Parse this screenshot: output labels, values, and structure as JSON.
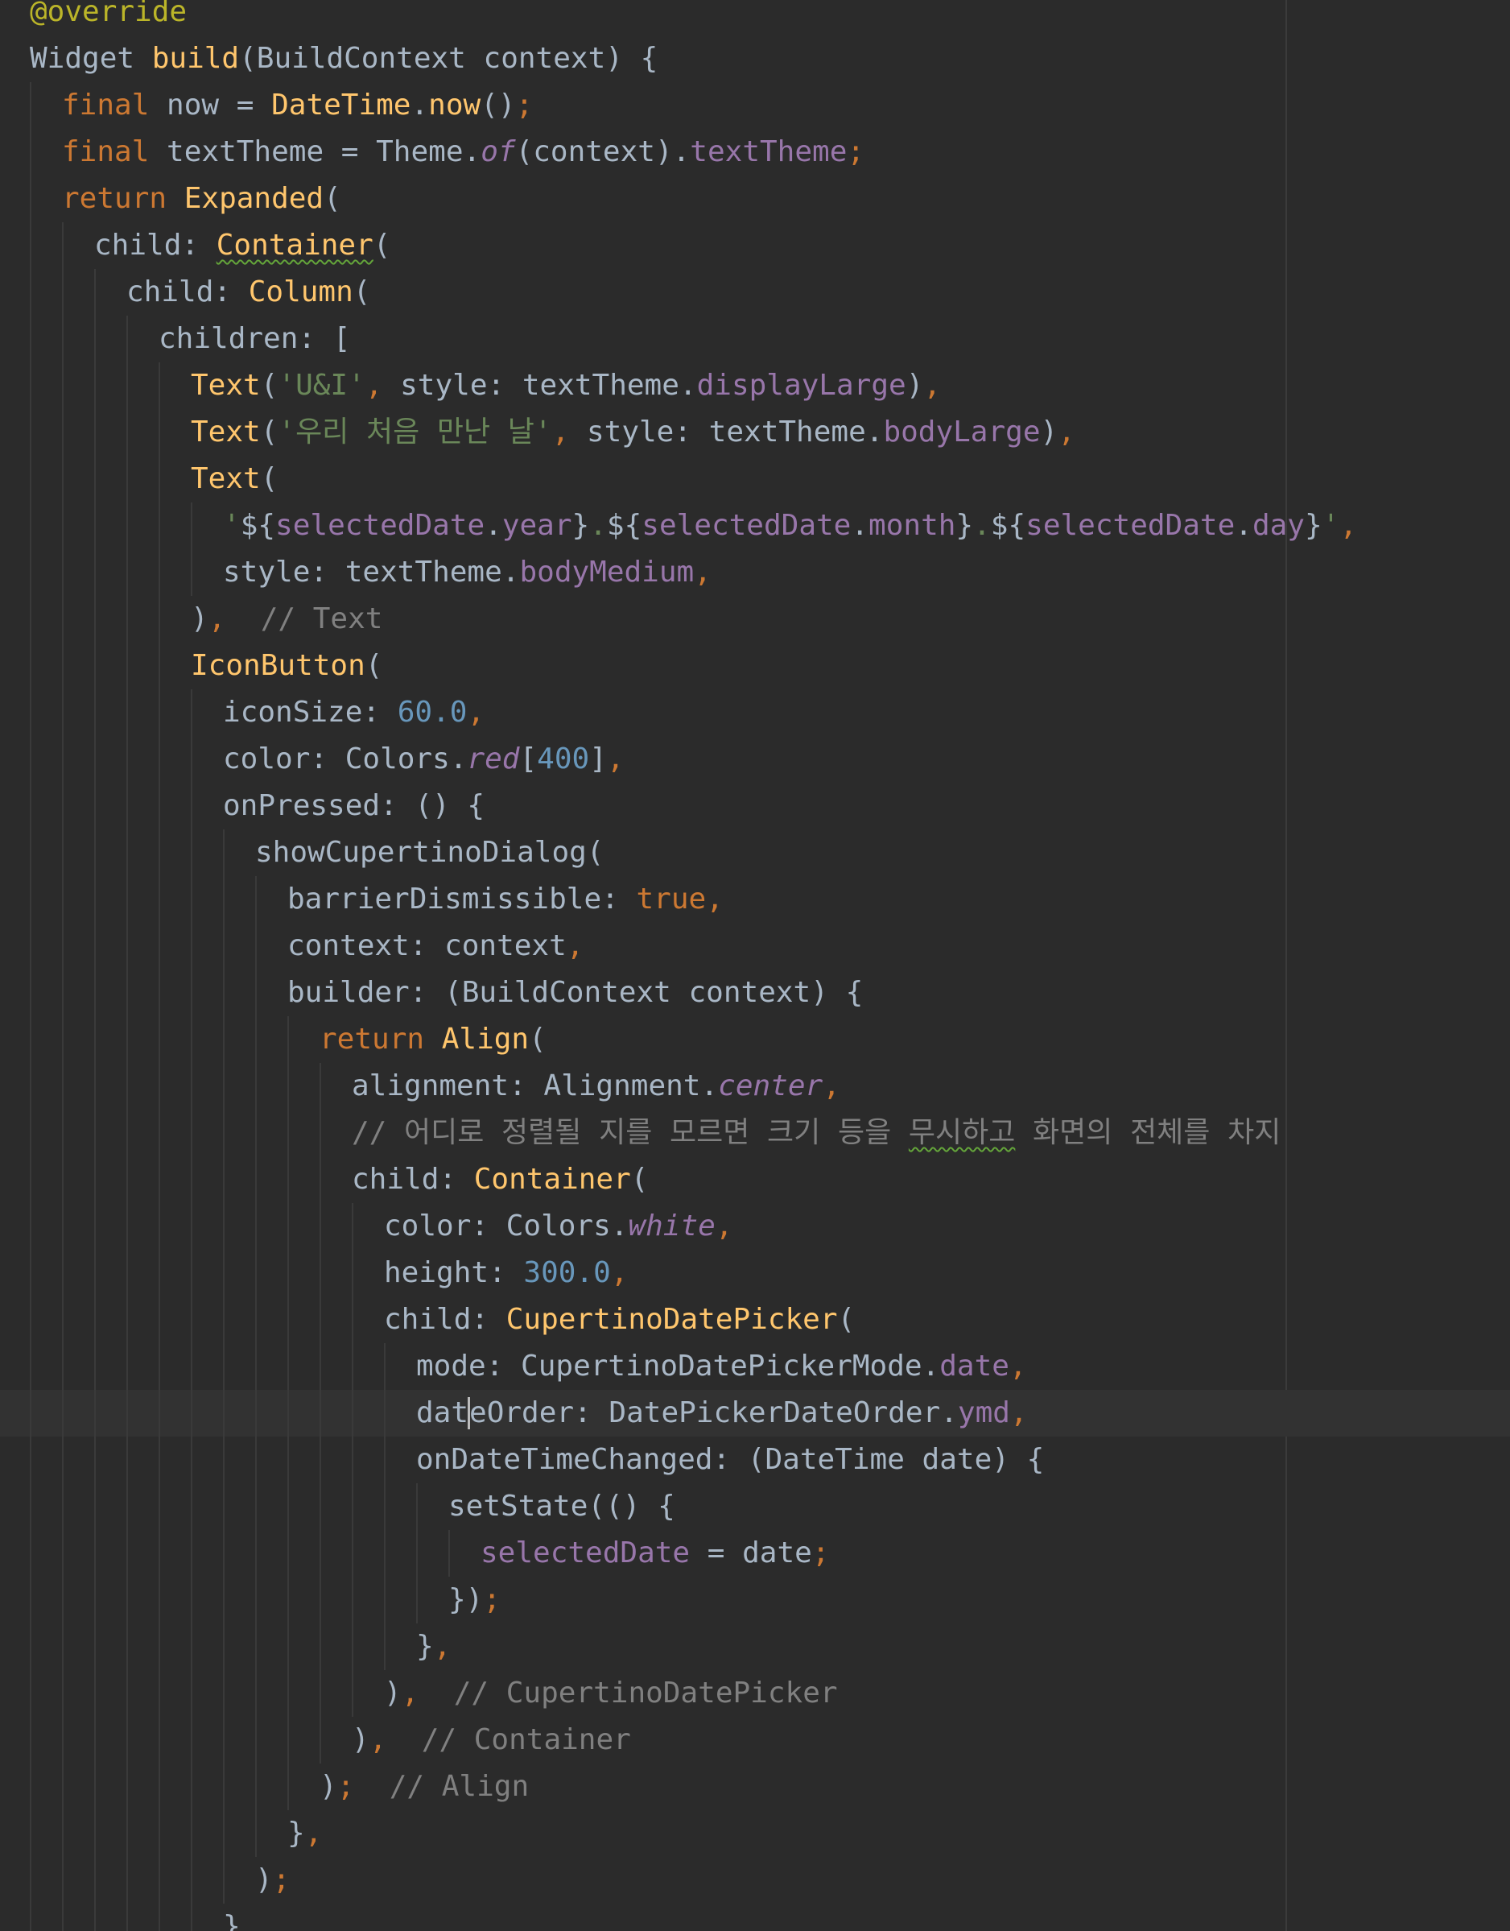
{
  "editor": {
    "colors": {
      "background": "#2b2b2b",
      "current_line": "#323232",
      "default_text": "#a9b7c6",
      "keyword": "#cc7832",
      "class_or_function": "#ffc66d",
      "string": "#6a8759",
      "number": "#6897bb",
      "field": "#9876aa",
      "comment": "#808080",
      "annotation": "#bbb529"
    },
    "current_line_index": 30,
    "lines": [
      {
        "indent": 0,
        "tokens": [
          {
            "t": "@override",
            "c": "ann"
          }
        ]
      },
      {
        "indent": 0,
        "tokens": [
          {
            "t": "Widget ",
            "c": "text"
          },
          {
            "t": "build",
            "c": "fn"
          },
          {
            "t": "(BuildContext context) {",
            "c": "text"
          }
        ]
      },
      {
        "indent": 1,
        "tokens": [
          {
            "t": "final ",
            "c": "kw"
          },
          {
            "t": "now = ",
            "c": "text"
          },
          {
            "t": "DateTime",
            "c": "cls"
          },
          {
            "t": ".",
            "c": "text"
          },
          {
            "t": "now",
            "c": "fn"
          },
          {
            "t": "()",
            "c": "text"
          },
          {
            "t": ";",
            "c": "punc"
          }
        ]
      },
      {
        "indent": 1,
        "tokens": [
          {
            "t": "final ",
            "c": "kw"
          },
          {
            "t": "textTheme = Theme.",
            "c": "text"
          },
          {
            "t": "of",
            "c": "stat"
          },
          {
            "t": "(context).",
            "c": "text"
          },
          {
            "t": "textTheme",
            "c": "fld"
          },
          {
            "t": ";",
            "c": "punc"
          }
        ]
      },
      {
        "indent": 1,
        "tokens": [
          {
            "t": "return ",
            "c": "kw"
          },
          {
            "t": "Expanded",
            "c": "cls"
          },
          {
            "t": "(",
            "c": "text"
          }
        ]
      },
      {
        "indent": 2,
        "tokens": [
          {
            "t": "child: ",
            "c": "text"
          },
          {
            "t": "Container",
            "c": "cls",
            "u": "warn"
          },
          {
            "t": "(",
            "c": "text"
          }
        ]
      },
      {
        "indent": 3,
        "tokens": [
          {
            "t": "child: ",
            "c": "text"
          },
          {
            "t": "Column",
            "c": "cls"
          },
          {
            "t": "(",
            "c": "text"
          }
        ]
      },
      {
        "indent": 4,
        "tokens": [
          {
            "t": "children: [",
            "c": "text"
          }
        ]
      },
      {
        "indent": 5,
        "tokens": [
          {
            "t": "Text",
            "c": "cls"
          },
          {
            "t": "(",
            "c": "text"
          },
          {
            "t": "'U&I'",
            "c": "str"
          },
          {
            "t": ", ",
            "c": "punc"
          },
          {
            "t": "style: textTheme.",
            "c": "text"
          },
          {
            "t": "displayLarge",
            "c": "fld"
          },
          {
            "t": ")",
            "c": "text"
          },
          {
            "t": ",",
            "c": "punc"
          }
        ]
      },
      {
        "indent": 5,
        "tokens": [
          {
            "t": "Text",
            "c": "cls"
          },
          {
            "t": "(",
            "c": "text"
          },
          {
            "t": "'우리 처음 만난 날'",
            "c": "str"
          },
          {
            "t": ", ",
            "c": "punc"
          },
          {
            "t": "style: textTheme.",
            "c": "text"
          },
          {
            "t": "bodyLarge",
            "c": "fld"
          },
          {
            "t": ")",
            "c": "text"
          },
          {
            "t": ",",
            "c": "punc"
          }
        ]
      },
      {
        "indent": 5,
        "tokens": [
          {
            "t": "Text",
            "c": "cls"
          },
          {
            "t": "(",
            "c": "text"
          }
        ]
      },
      {
        "indent": 6,
        "tokens": [
          {
            "t": "'",
            "c": "str"
          },
          {
            "t": "${",
            "c": "text"
          },
          {
            "t": "selectedDate",
            "c": "fld"
          },
          {
            "t": ".",
            "c": "text"
          },
          {
            "t": "year",
            "c": "fld"
          },
          {
            "t": "}",
            "c": "text"
          },
          {
            "t": ".",
            "c": "str"
          },
          {
            "t": "${",
            "c": "text"
          },
          {
            "t": "selectedDate",
            "c": "fld"
          },
          {
            "t": ".",
            "c": "text"
          },
          {
            "t": "month",
            "c": "fld"
          },
          {
            "t": "}",
            "c": "text"
          },
          {
            "t": ".",
            "c": "str"
          },
          {
            "t": "${",
            "c": "text"
          },
          {
            "t": "selectedDate",
            "c": "fld"
          },
          {
            "t": ".",
            "c": "text"
          },
          {
            "t": "day",
            "c": "fld"
          },
          {
            "t": "}",
            "c": "text"
          },
          {
            "t": "'",
            "c": "str"
          },
          {
            "t": ",",
            "c": "punc"
          }
        ]
      },
      {
        "indent": 6,
        "tokens": [
          {
            "t": "style: textTheme.",
            "c": "text"
          },
          {
            "t": "bodyMedium",
            "c": "fld"
          },
          {
            "t": ",",
            "c": "punc"
          }
        ]
      },
      {
        "indent": 5,
        "tokens": [
          {
            "t": ")",
            "c": "text"
          },
          {
            "t": ",",
            "c": "punc"
          },
          {
            "t": "  // Text",
            "c": "cmt"
          }
        ]
      },
      {
        "indent": 5,
        "tokens": [
          {
            "t": "IconButton",
            "c": "cls"
          },
          {
            "t": "(",
            "c": "text"
          }
        ]
      },
      {
        "indent": 6,
        "tokens": [
          {
            "t": "iconSize: ",
            "c": "text"
          },
          {
            "t": "60.0",
            "c": "num"
          },
          {
            "t": ",",
            "c": "punc"
          }
        ]
      },
      {
        "indent": 6,
        "tokens": [
          {
            "t": "color: Colors.",
            "c": "text"
          },
          {
            "t": "red",
            "c": "stat"
          },
          {
            "t": "[",
            "c": "text"
          },
          {
            "t": "400",
            "c": "num"
          },
          {
            "t": "]",
            "c": "text"
          },
          {
            "t": ",",
            "c": "punc"
          }
        ]
      },
      {
        "indent": 6,
        "tokens": [
          {
            "t": "onPressed: () {",
            "c": "text"
          }
        ]
      },
      {
        "indent": 7,
        "tokens": [
          {
            "t": "showCupertinoDialog(",
            "c": "text"
          }
        ]
      },
      {
        "indent": 8,
        "tokens": [
          {
            "t": "barrierDismissible: ",
            "c": "text"
          },
          {
            "t": "true",
            "c": "kw"
          },
          {
            "t": ",",
            "c": "punc"
          }
        ]
      },
      {
        "indent": 8,
        "tokens": [
          {
            "t": "context: context",
            "c": "text"
          },
          {
            "t": ",",
            "c": "punc"
          }
        ]
      },
      {
        "indent": 8,
        "tokens": [
          {
            "t": "builder: (BuildContext context) {",
            "c": "text"
          }
        ]
      },
      {
        "indent": 9,
        "tokens": [
          {
            "t": "return ",
            "c": "kw"
          },
          {
            "t": "Align",
            "c": "cls"
          },
          {
            "t": "(",
            "c": "text"
          }
        ]
      },
      {
        "indent": 10,
        "tokens": [
          {
            "t": "alignment: Alignment.",
            "c": "text"
          },
          {
            "t": "center",
            "c": "stat"
          },
          {
            "t": ",",
            "c": "punc"
          }
        ]
      },
      {
        "indent": 10,
        "tokens": [
          {
            "t": "// 어디로 정렬될 지를 모르면 크기 등을 ",
            "c": "cmt"
          },
          {
            "t": "무시하고",
            "c": "cmt",
            "u": "warn"
          },
          {
            "t": " 화면의 전체를 차지",
            "c": "cmt"
          }
        ]
      },
      {
        "indent": 10,
        "tokens": [
          {
            "t": "child: ",
            "c": "text"
          },
          {
            "t": "Container",
            "c": "cls"
          },
          {
            "t": "(",
            "c": "text"
          }
        ]
      },
      {
        "indent": 11,
        "tokens": [
          {
            "t": "color: Colors.",
            "c": "text"
          },
          {
            "t": "white",
            "c": "stat"
          },
          {
            "t": ",",
            "c": "punc"
          }
        ]
      },
      {
        "indent": 11,
        "tokens": [
          {
            "t": "height: ",
            "c": "text"
          },
          {
            "t": "300.0",
            "c": "num"
          },
          {
            "t": ",",
            "c": "punc"
          }
        ]
      },
      {
        "indent": 11,
        "tokens": [
          {
            "t": "child: ",
            "c": "text"
          },
          {
            "t": "CupertinoDatePicker",
            "c": "cls"
          },
          {
            "t": "(",
            "c": "text"
          }
        ]
      },
      {
        "indent": 12,
        "tokens": [
          {
            "t": "mode: CupertinoDatePickerMode.",
            "c": "text"
          },
          {
            "t": "date",
            "c": "fld"
          },
          {
            "t": ",",
            "c": "punc"
          }
        ]
      },
      {
        "indent": 12,
        "caret_after": 0,
        "tokens": [
          {
            "t": "dat",
            "c": "text"
          },
          {
            "t": "eOrder: DatePickerDateOrder.",
            "c": "text"
          },
          {
            "t": "ymd",
            "c": "fld"
          },
          {
            "t": ",",
            "c": "punc"
          }
        ]
      },
      {
        "indent": 12,
        "tokens": [
          {
            "t": "onDateTimeChanged: (DateTime date) {",
            "c": "text"
          }
        ]
      },
      {
        "indent": 13,
        "tokens": [
          {
            "t": "setState(() {",
            "c": "text"
          }
        ]
      },
      {
        "indent": 14,
        "tokens": [
          {
            "t": "selectedDate",
            "c": "fld"
          },
          {
            "t": " = date",
            "c": "text"
          },
          {
            "t": ";",
            "c": "punc"
          }
        ]
      },
      {
        "indent": 13,
        "tokens": [
          {
            "t": "})",
            "c": "text"
          },
          {
            "t": ";",
            "c": "punc"
          }
        ]
      },
      {
        "indent": 12,
        "tokens": [
          {
            "t": "}",
            "c": "text"
          },
          {
            "t": ",",
            "c": "punc"
          }
        ]
      },
      {
        "indent": 11,
        "tokens": [
          {
            "t": ")",
            "c": "text"
          },
          {
            "t": ",",
            "c": "punc"
          },
          {
            "t": "  // CupertinoDatePicker",
            "c": "cmt"
          }
        ]
      },
      {
        "indent": 10,
        "tokens": [
          {
            "t": ")",
            "c": "text"
          },
          {
            "t": ",",
            "c": "punc"
          },
          {
            "t": "  // Container",
            "c": "cmt"
          }
        ]
      },
      {
        "indent": 9,
        "tokens": [
          {
            "t": ")",
            "c": "text"
          },
          {
            "t": ";",
            "c": "punc"
          },
          {
            "t": "  // Align",
            "c": "cmt"
          }
        ]
      },
      {
        "indent": 8,
        "tokens": [
          {
            "t": "}",
            "c": "text"
          },
          {
            "t": ",",
            "c": "punc"
          }
        ]
      },
      {
        "indent": 7,
        "tokens": [
          {
            "t": ")",
            "c": "text"
          },
          {
            "t": ";",
            "c": "punc"
          }
        ]
      },
      {
        "indent": 6,
        "tokens": [
          {
            "t": "}",
            "c": "text"
          }
        ]
      }
    ]
  }
}
